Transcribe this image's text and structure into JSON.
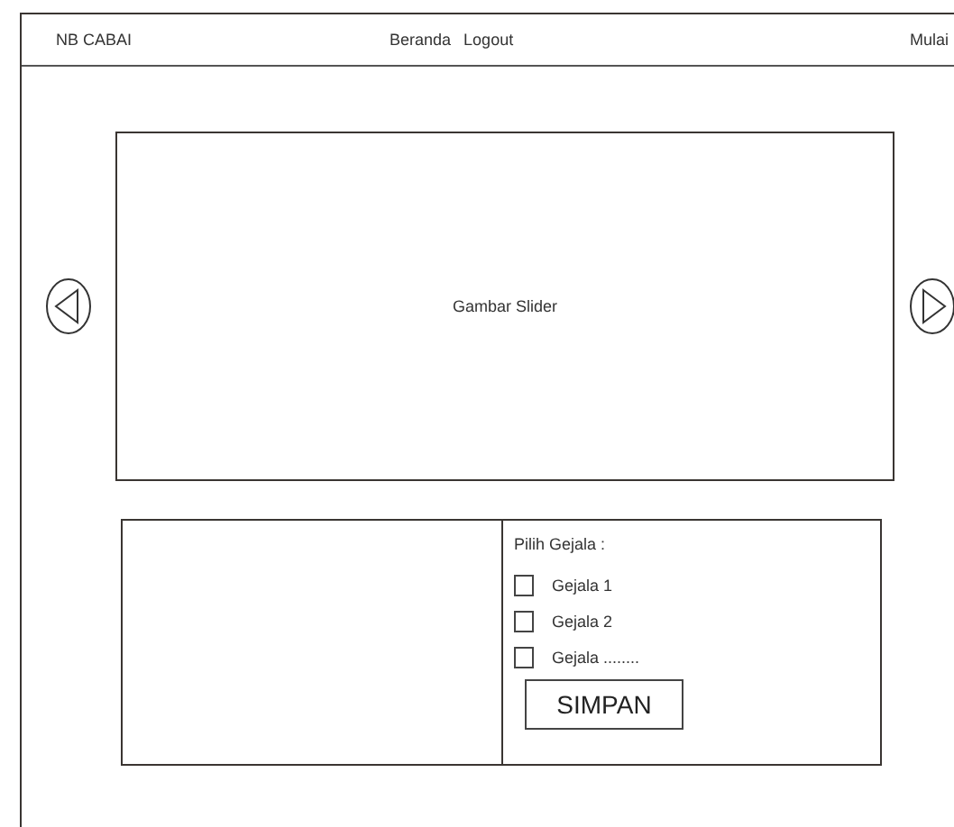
{
  "header": {
    "brand": "NB CABAI",
    "nav": [
      "Beranda",
      "Logout"
    ],
    "action": "Mulai"
  },
  "slider": {
    "label": "Gambar Slider"
  },
  "form": {
    "title": "Pilih Gejala :",
    "options": [
      {
        "label": "Gejala 1",
        "checked": false
      },
      {
        "label": "Gejala 2",
        "checked": false
      },
      {
        "label": "Gejala ........",
        "checked": false
      }
    ],
    "button": "SIMPAN"
  }
}
